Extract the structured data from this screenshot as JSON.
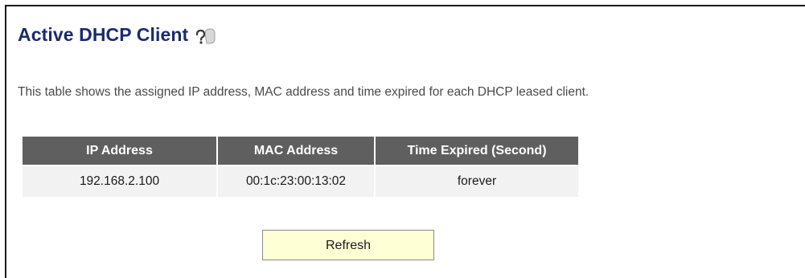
{
  "page": {
    "title": "Active DHCP Client",
    "help_icon": "help-question-icon",
    "description": "This table shows the assigned IP address, MAC address and time expired for each DHCP leased client."
  },
  "table": {
    "headers": [
      "IP Address",
      "MAC Address",
      "Time Expired (Second)"
    ],
    "rows": [
      [
        "192.168.2.100",
        "00:1c:23:00:13:02",
        "forever"
      ]
    ]
  },
  "actions": {
    "refresh_label": "Refresh"
  },
  "colors": {
    "title": "#1c2a6e",
    "header_bg": "#5f5f5f",
    "row_bg": "#f2f2f2",
    "button_bg": "#ffffd6"
  }
}
